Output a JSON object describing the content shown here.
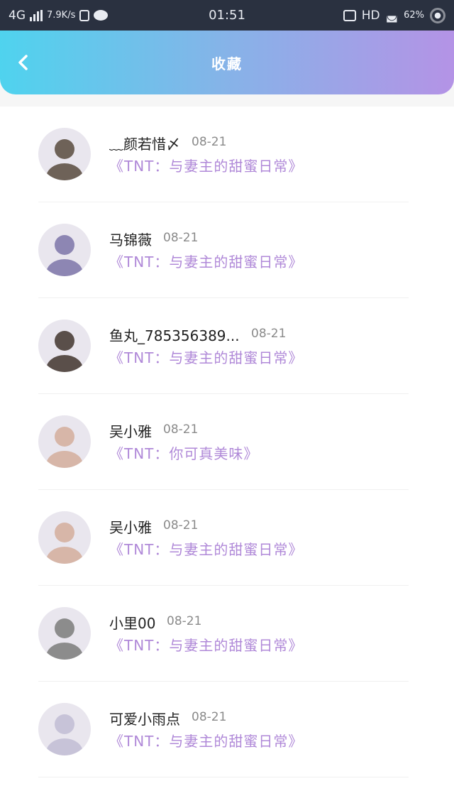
{
  "status_bar": {
    "network": "4G",
    "speed": "7.9K/s",
    "time": "01:51",
    "hd": "HD",
    "battery": "62%"
  },
  "header": {
    "title": "收藏",
    "back_icon": "chevron-left-icon"
  },
  "favorites": [
    {
      "name": "﹏颜若惜〆",
      "date": "08-21",
      "message": "《TNT：与妻主的甜蜜日常》",
      "avatar_color": "#6e6258"
    },
    {
      "name": "马锦薇",
      "date": "08-21",
      "message": "《TNT：与妻主的甜蜜日常》",
      "avatar_color": "#8d86b3"
    },
    {
      "name": "鱼丸_785356389...",
      "date": "08-21",
      "message": "《TNT：与妻主的甜蜜日常》",
      "avatar_color": "#5a4f4a"
    },
    {
      "name": "吴小雅",
      "date": "08-21",
      "message": "《TNT：你可真美味》",
      "avatar_color": "#d7b6a8"
    },
    {
      "name": "吴小雅",
      "date": "08-21",
      "message": "《TNT：与妻主的甜蜜日常》",
      "avatar_color": "#d7b6a8"
    },
    {
      "name": "小里00",
      "date": "08-21",
      "message": "《TNT：与妻主的甜蜜日常》",
      "avatar_color": "#8c8c8c"
    },
    {
      "name": "可爱小雨点",
      "date": "08-21",
      "message": "《TNT：与妻主的甜蜜日常》",
      "avatar_color": "#c7c3d8"
    }
  ]
}
